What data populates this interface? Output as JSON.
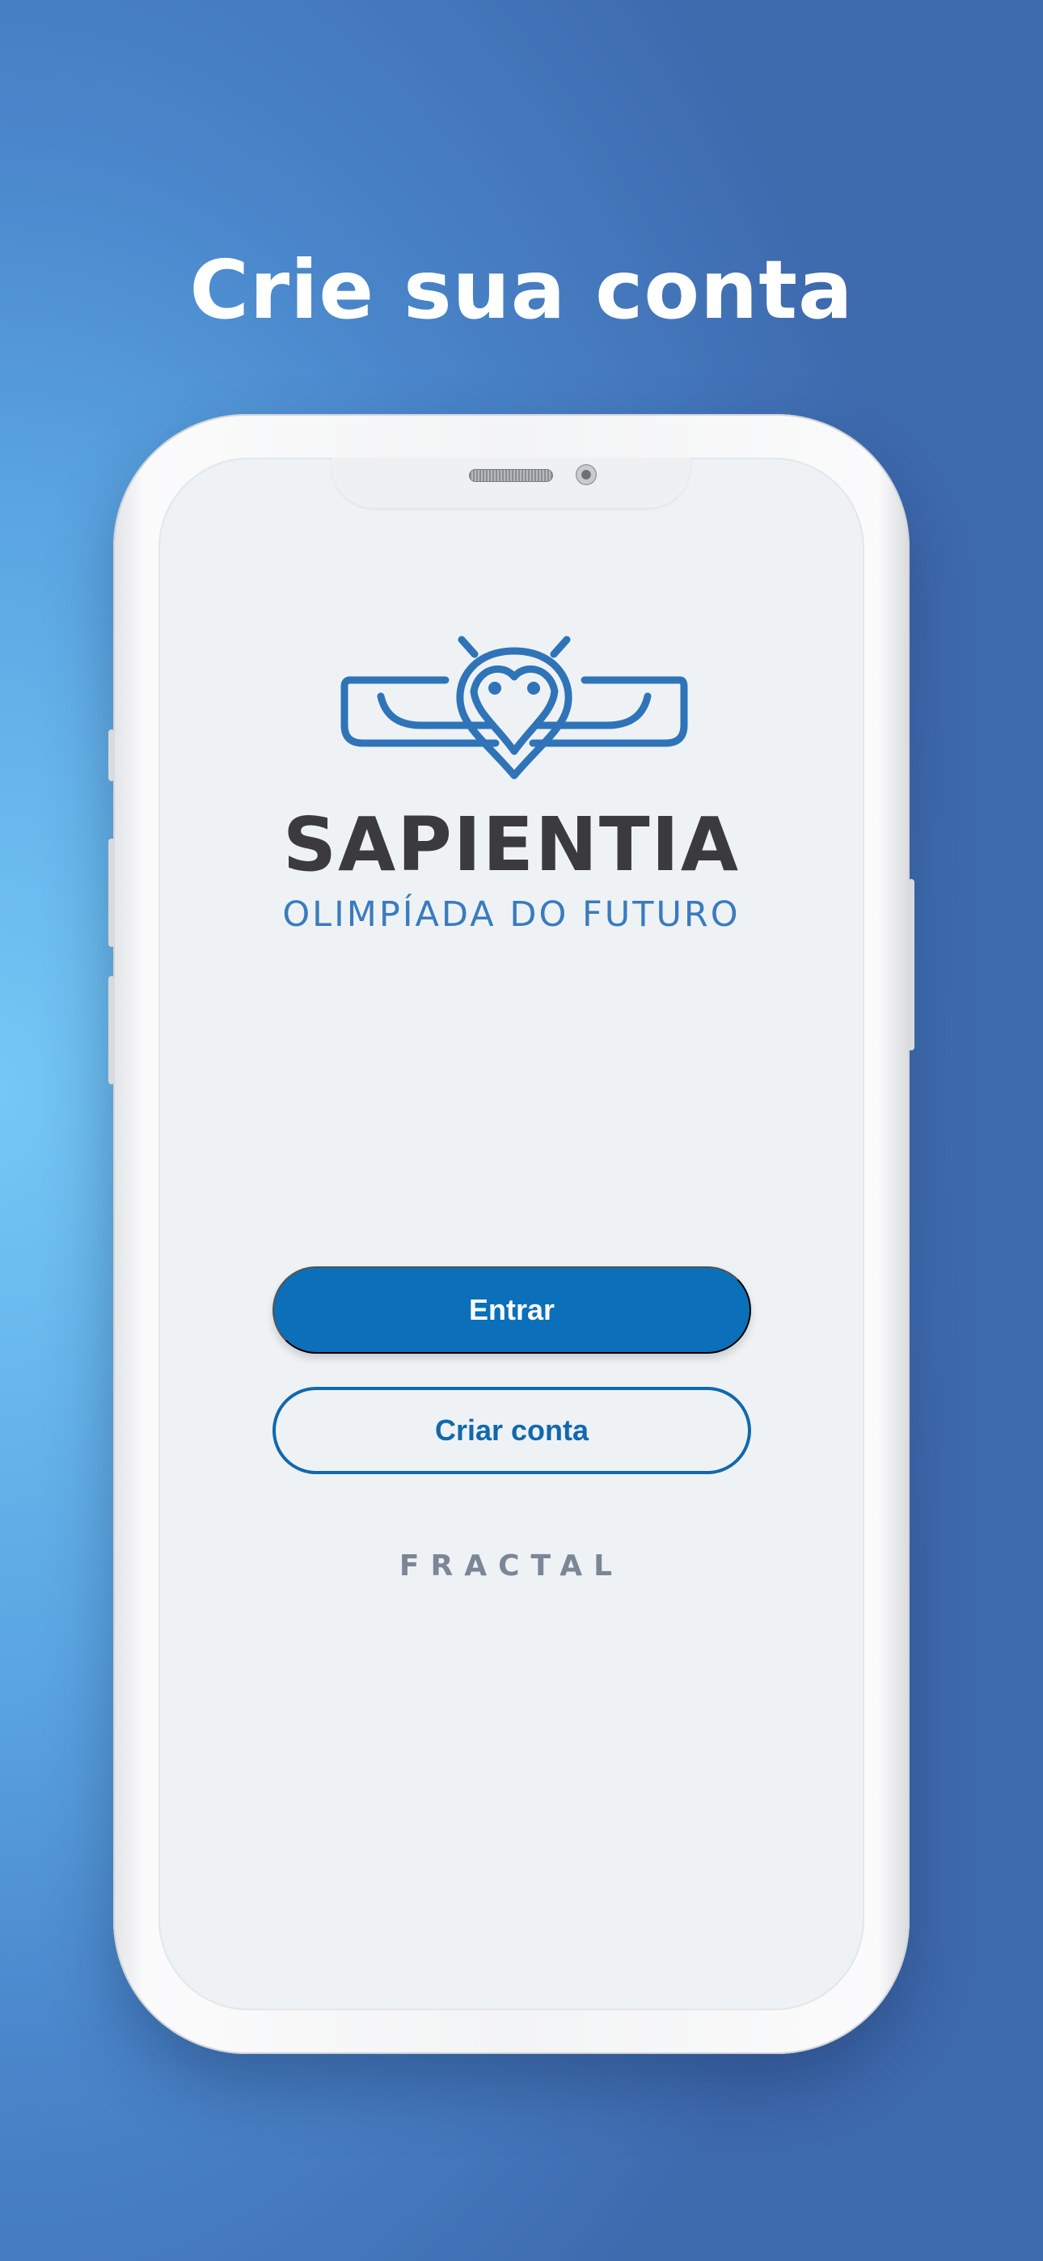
{
  "header": {
    "title": "Crie sua conta"
  },
  "app": {
    "brand_name": "SAPIENTIA",
    "brand_subtitle": "OLIMPÍADA DO FUTURO",
    "logo_icon": "owl-logo-icon",
    "login_label": "Entrar",
    "signup_label": "Criar conta",
    "footer_brand": "FRACTAL"
  },
  "colors": {
    "primary": "#0b6fb9",
    "logo_blue": "#2f74b8",
    "brand_dark": "#3b3b3d",
    "background_light": "#74c8f6",
    "background_dark": "#3e6aae"
  }
}
